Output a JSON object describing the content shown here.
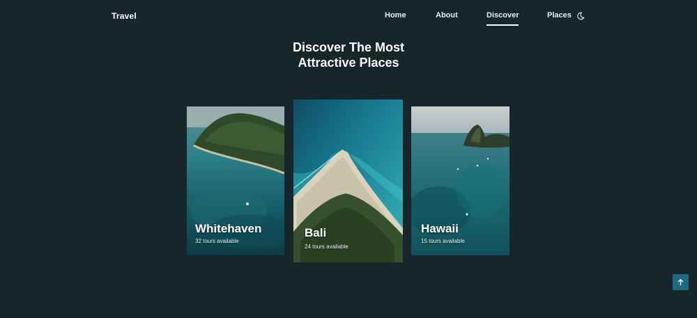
{
  "brand": "Travel",
  "nav": {
    "items": [
      {
        "label": "Home",
        "active": false
      },
      {
        "label": "About",
        "active": false
      },
      {
        "label": "Discover",
        "active": true
      },
      {
        "label": "Places",
        "active": false
      }
    ],
    "theme_icon": "moon-icon"
  },
  "section": {
    "title_line1": "Discover The Most",
    "title_line2": "Attractive Places"
  },
  "cards": [
    {
      "name": "Whitehaven",
      "tours": "32 tours available"
    },
    {
      "name": "Bali",
      "tours": "24 tours available"
    },
    {
      "name": "Hawaii",
      "tours": "15 tours available"
    }
  ],
  "scroll_top_icon": "arrow-up-icon",
  "colors": {
    "background": "#17262a",
    "accent": "#1d6c84",
    "text": "#ffffff"
  }
}
